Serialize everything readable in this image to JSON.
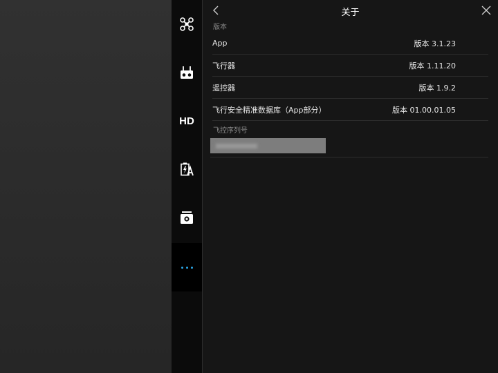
{
  "header": {
    "title": "关于"
  },
  "sidebar": {
    "items": [
      {
        "name": "aircraft",
        "icon": "drone-icon"
      },
      {
        "name": "remote-controller",
        "icon": "remote-controller-icon"
      },
      {
        "name": "hd-transmission",
        "icon": "hd-icon",
        "label": "HD"
      },
      {
        "name": "battery",
        "icon": "battery-icon"
      },
      {
        "name": "camera",
        "icon": "camera-icon"
      },
      {
        "name": "more",
        "icon": "more-dots-icon",
        "active": true
      }
    ],
    "accent": "#2aa7e8"
  },
  "version_section": {
    "label": "版本",
    "rows": [
      {
        "label": "App",
        "value": "版本 3.1.23"
      },
      {
        "label": "飞行器",
        "value": "版本 1.11.20"
      },
      {
        "label": "遥控器",
        "value": "版本 1.9.2"
      },
      {
        "label": "飞行安全精准数据库（App部分）",
        "value": "版本 01.00.01.05"
      }
    ]
  },
  "serial_section": {
    "label": "飞控序列号"
  }
}
